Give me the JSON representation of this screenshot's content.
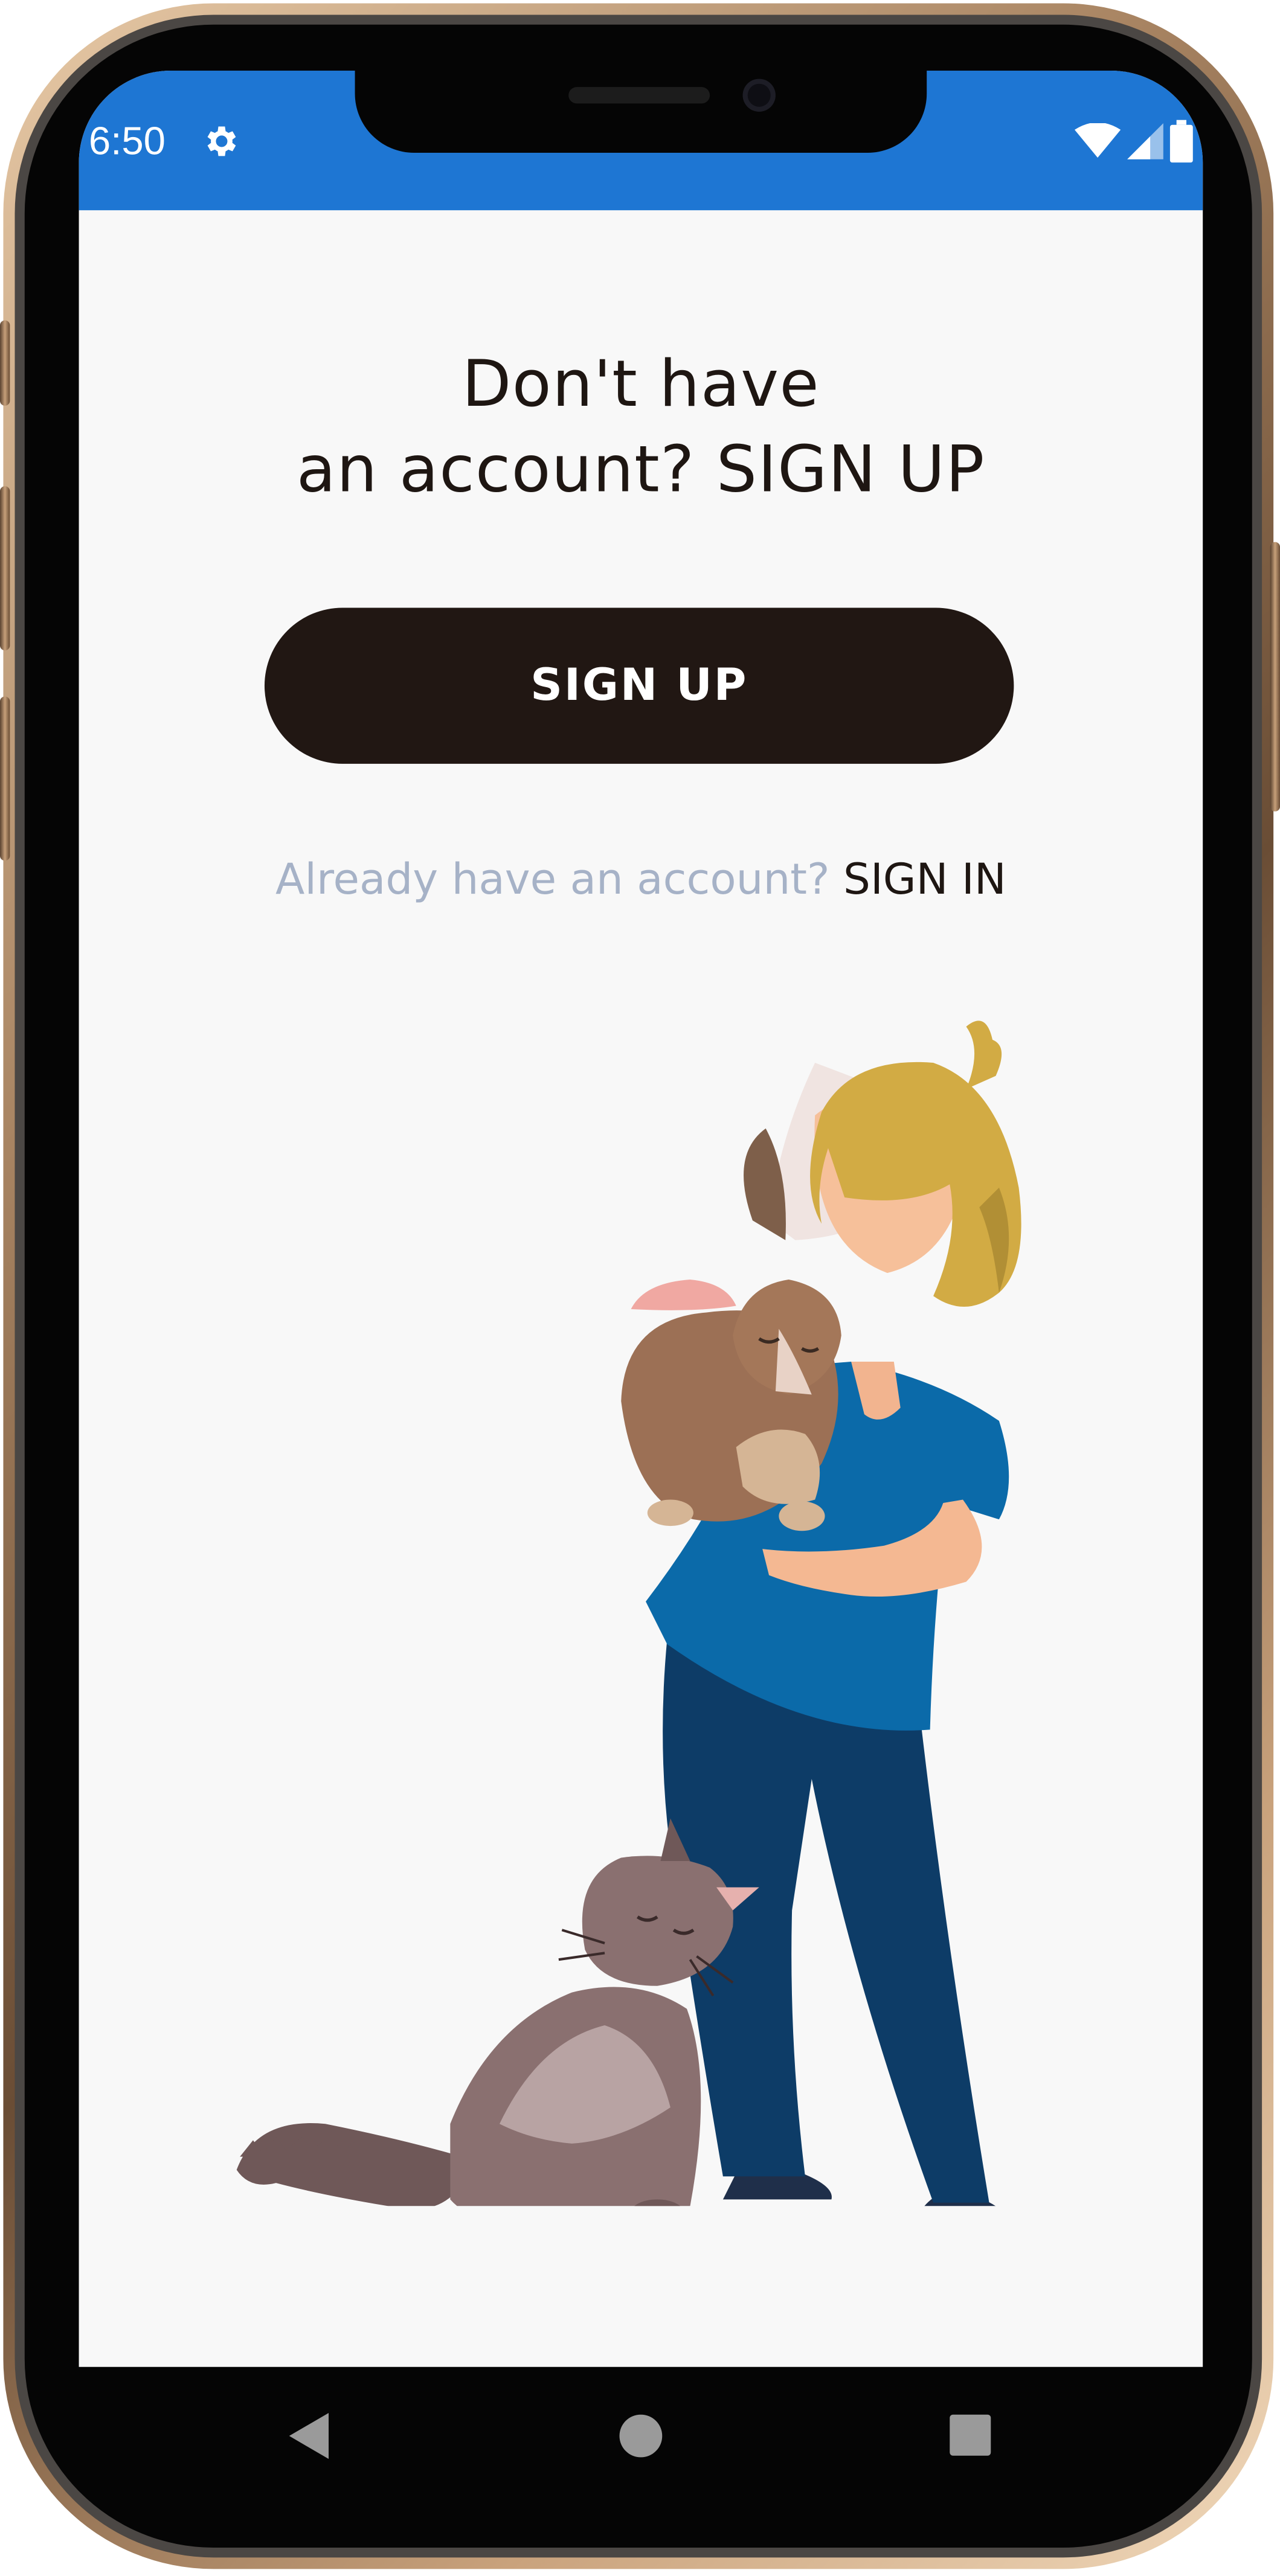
{
  "status_bar": {
    "time": "6:50",
    "color": "#1e76d3"
  },
  "main": {
    "headline_line1": "Don't have",
    "headline_line2": "an account? SIGN UP",
    "signup_button_label": "SIGN UP",
    "signin_prompt": "Already have an account?",
    "signin_link": "SIGN IN"
  },
  "colors": {
    "button": "#211713",
    "prompt_text": "#a6b2c7",
    "background": "#f8f8f8"
  },
  "icons": {
    "status_left": "gear-icon",
    "status_right": [
      "wifi-icon",
      "cellular-signal-icon",
      "battery-icon"
    ],
    "navigation": [
      "back-icon",
      "home-icon",
      "recents-icon"
    ]
  }
}
